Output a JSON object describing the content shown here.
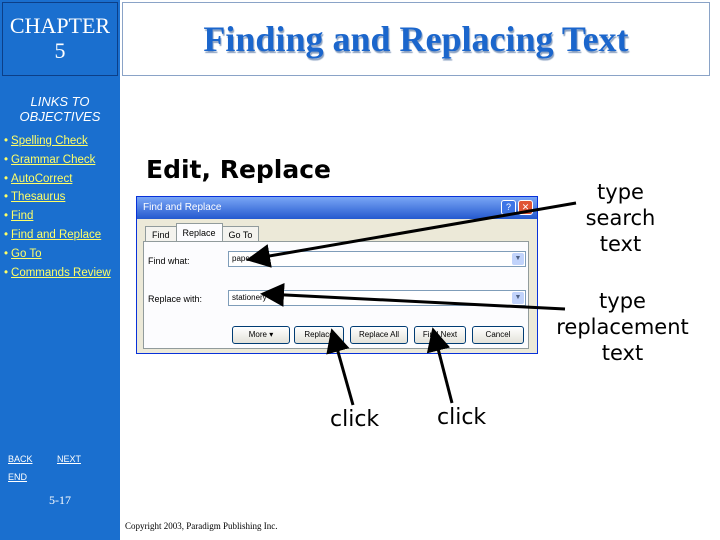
{
  "chapter": {
    "line1": "CHAPTER",
    "line2": "5"
  },
  "title": "Finding and Replacing Text",
  "sidebar": {
    "links_heading_line1": "LINKS TO",
    "links_heading_line2": "OBJECTIVES",
    "items": [
      {
        "label": "Spelling Check"
      },
      {
        "label": "Grammar Check"
      },
      {
        "label": "AutoCorrect"
      },
      {
        "label": "Thesaurus"
      },
      {
        "label": "Find"
      },
      {
        "label": "Find and Replace"
      },
      {
        "label": "Go To"
      },
      {
        "label": "Commands Review"
      }
    ],
    "bullet": "•",
    "nav": {
      "back": "BACK",
      "next": "NEXT",
      "end": "END"
    },
    "slide_number": "5-17"
  },
  "heading": "Edit, Replace",
  "dialog": {
    "title": "Find and Replace",
    "help_glyph": "?",
    "close_glyph": "✕",
    "tabs": [
      "Find",
      "Replace",
      "Go To"
    ],
    "find_label": "Find what:",
    "find_value": "paper",
    "replace_label": "Replace with:",
    "replace_value": "stationery",
    "dropdown_glyph": "▼",
    "buttons": {
      "more": "More ▾",
      "replace": "Replace",
      "replace_all": "Replace All",
      "find_next": "Find Next",
      "cancel": "Cancel"
    }
  },
  "annotations": {
    "search": [
      "type",
      "search",
      "text"
    ],
    "replacement": [
      "type",
      "replacement",
      "text"
    ],
    "click1": "click",
    "click2": "click"
  },
  "copyright": "Copyright 2003, Paradigm Publishing Inc.",
  "colors": {
    "sidebar": "#1a6fcf",
    "title": "#1b66cc",
    "link": "#ffff66"
  }
}
